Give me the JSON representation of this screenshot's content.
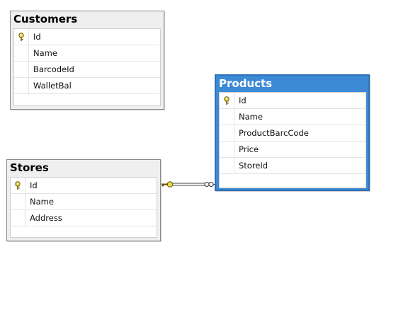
{
  "tables": {
    "customers": {
      "title": "Customers",
      "columns": [
        {
          "name": "Id",
          "key": true
        },
        {
          "name": "Name",
          "key": false
        },
        {
          "name": "BarcodeId",
          "key": false
        },
        {
          "name": "WalletBal",
          "key": false
        }
      ]
    },
    "products": {
      "title": "Products",
      "selected": true,
      "columns": [
        {
          "name": "Id",
          "key": true
        },
        {
          "name": "Name",
          "key": false
        },
        {
          "name": "ProductBarcCode",
          "key": false
        },
        {
          "name": "Price",
          "key": false
        },
        {
          "name": "StoreId",
          "key": false
        }
      ]
    },
    "stores": {
      "title": "Stores",
      "columns": [
        {
          "name": "Id",
          "key": true
        },
        {
          "name": "Name",
          "key": false
        },
        {
          "name": "Address",
          "key": false
        }
      ]
    }
  },
  "relationship": {
    "from": "stores",
    "to": "products",
    "from_end": "key-icon",
    "to_end": "infinity-icon"
  },
  "colors": {
    "selected_header": "#3c8ad6",
    "key_icon": "#e8d94a",
    "border": "#8a8a8a"
  }
}
